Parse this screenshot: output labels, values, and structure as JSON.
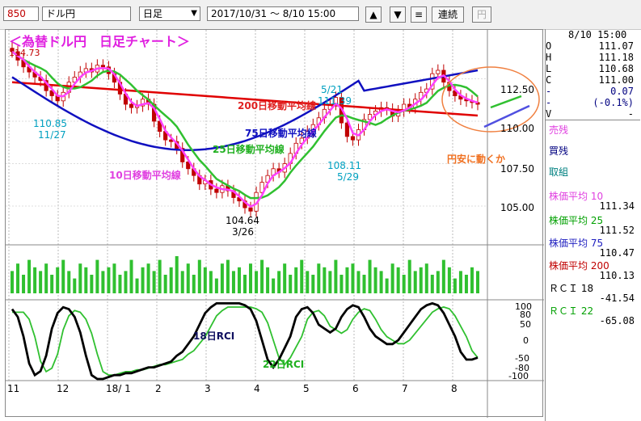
{
  "toolbar": {
    "code": "850",
    "name": "ドル円",
    "period": "日足",
    "range": "2017/10/31 〜 8/10 15:00",
    "up_icon": "triangle-up-icon",
    "down_icon": "triangle-down-icon",
    "menu_icon": "list-icon",
    "continuous_label": "連続",
    "yen_label": "円"
  },
  "chart_data": {
    "type": "candlestick",
    "title": "＜為替ドル円　日足チャート＞",
    "price_axis_ticks": [
      "112.50",
      "110.00",
      "107.50",
      "105.00"
    ],
    "x_tick_labels": [
      "11",
      "12",
      "18/ 1",
      "2",
      "3",
      "4",
      "5",
      "6",
      "7",
      "8"
    ],
    "ylim": [
      103.0,
      115.0
    ],
    "close_series_approx": [
      114.1,
      113.6,
      113.2,
      112.9,
      112.6,
      112.4,
      111.8,
      111.5,
      111.2,
      111.7,
      112.3,
      112.6,
      112.9,
      113.1,
      112.9,
      113.3,
      113.2,
      112.8,
      112.3,
      111.6,
      111.0,
      110.8,
      110.9,
      111.3,
      111.0,
      110.0,
      109.4,
      108.9,
      108.8,
      108.4,
      107.6,
      107.2,
      106.8,
      106.3,
      106.5,
      106.0,
      105.8,
      106.2,
      105.9,
      105.5,
      105.3,
      104.9,
      104.7,
      105.8,
      106.4,
      106.8,
      107.2,
      107.0,
      107.5,
      108.1,
      108.7,
      109.0,
      109.4,
      109.8,
      110.2,
      110.7,
      111.0,
      111.4,
      109.9,
      109.1,
      108.9,
      109.5,
      110.1,
      110.4,
      110.6,
      110.8,
      110.7,
      110.3,
      110.6,
      111.0,
      110.8,
      111.3,
      111.7,
      111.9,
      112.8,
      113.0,
      112.3,
      111.8,
      111.5,
      111.3,
      111.2,
      111.1,
      111.0
    ],
    "ma_labels": {
      "ma200": "200日移動平均線",
      "ma75": "75日移動平均線",
      "ma25": "25日移動平均線",
      "ma10": "10日移動平均線"
    },
    "annotations": {
      "high_price": "114.73",
      "low1_price": "110.85",
      "low1_date": "11/27",
      "low2_price": "104.64",
      "low2_date": "3/26",
      "peak_date": "5/21",
      "peak_price": "111.39",
      "dip_price": "108.11",
      "dip_date": "5/29",
      "forecast": "円安に動くか"
    },
    "volume_series_approx": [
      0.6,
      0.8,
      0.5,
      0.9,
      0.7,
      0.6,
      0.8,
      0.5,
      0.7,
      0.9,
      0.6,
      0.4,
      0.8,
      0.7,
      0.5,
      0.9,
      0.6,
      0.7,
      0.8,
      0.5,
      0.6,
      0.9,
      0.4,
      0.7,
      0.8,
      0.6,
      0.9,
      0.5,
      0.7,
      1.0,
      0.6,
      0.8,
      0.5,
      0.9,
      0.7,
      0.6,
      0.4,
      0.8,
      0.9,
      0.6,
      0.7,
      0.5,
      0.8,
      0.6,
      0.9,
      0.7,
      0.4,
      0.6,
      0.8,
      0.5,
      0.7,
      0.9,
      0.6,
      0.5,
      0.8,
      0.7,
      0.6,
      0.9,
      0.5,
      0.7,
      0.8,
      0.6,
      0.5,
      0.9,
      0.7,
      0.6,
      0.4,
      0.8,
      0.7,
      0.5,
      0.9,
      0.6,
      0.7,
      0.8,
      0.5,
      0.6,
      0.9,
      0.7,
      0.4,
      0.6,
      0.5,
      0.7,
      0.6
    ],
    "rci_axis_ticks": [
      "100",
      "80",
      "50",
      "0",
      "-50",
      "-80",
      "-100"
    ],
    "rci_labels": {
      "rci18": "18日RCI",
      "rci22": "22日RCI"
    }
  },
  "side_panel": {
    "date": "8/10 15:00",
    "ohlc": [
      {
        "k": "O",
        "v": "111.07"
      },
      {
        "k": "H",
        "v": "111.18"
      },
      {
        "k": "L",
        "v": "110.68"
      },
      {
        "k": "C",
        "v": "111.00"
      },
      {
        "k": "-",
        "v": "0.07"
      },
      {
        "k": "-",
        "v": "(-0.1%)"
      },
      {
        "k": "V",
        "v": "-"
      }
    ],
    "urizan": "売残",
    "kaizan": "買残",
    "torikumi": "取組",
    "ma10_label": "株価平均  10",
    "ma10_val": "111.34",
    "ma25_label": "株価平均  25",
    "ma25_val": "111.52",
    "ma75_label": "株価平均  75",
    "ma75_val": "110.47",
    "ma200_label": "株価平均 200",
    "ma200_val": "110.13",
    "rci18_label": "ＲＣＩ     18",
    "rci18_val": "-41.54",
    "rci22_label": "ＲＣＩ     22",
    "rci22_val": "-65.08"
  },
  "colors": {
    "candle": "#c00000",
    "ma10": "#ff40ff",
    "ma25": "#30c030",
    "ma75": "#1010c0",
    "ma200": "#e00000",
    "volume": "#30c030",
    "rci18": "#000000",
    "rci22": "#30c030"
  }
}
